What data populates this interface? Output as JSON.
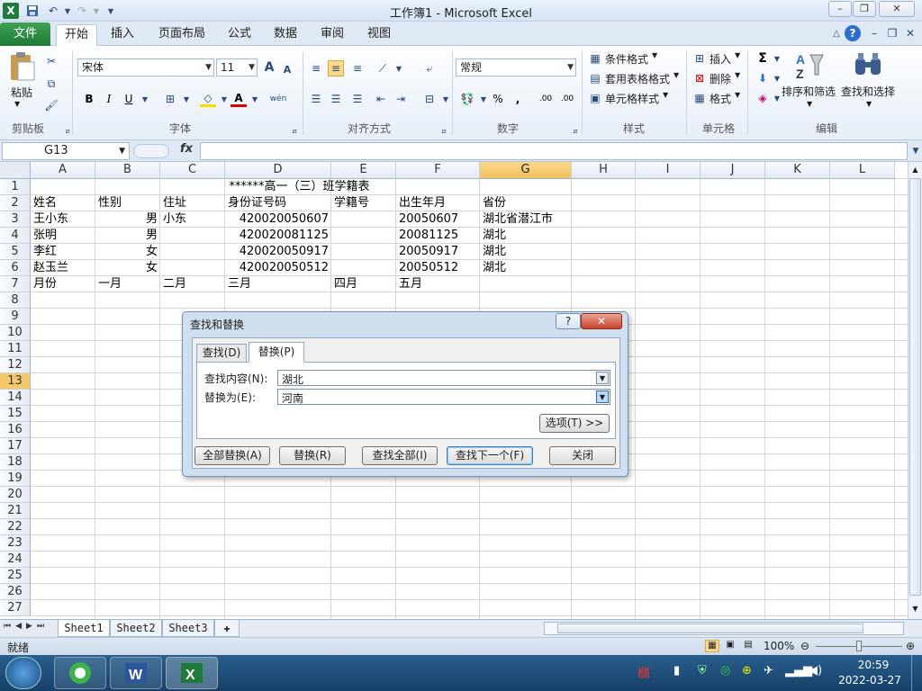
{
  "window": {
    "title": "工作簿1 - Microsoft Excel",
    "minimize": "–",
    "restore": "❐",
    "close": "✕"
  },
  "qat": {
    "save_icon": "save-icon",
    "undo_icon": "undo-icon",
    "redo_icon": "redo-icon"
  },
  "ribbon_tabs": {
    "file": "文件",
    "home": "开始",
    "insert": "插入",
    "page_layout": "页面布局",
    "formulas": "公式",
    "data": "数据",
    "review": "审阅",
    "view": "视图"
  },
  "ribbon": {
    "clipboard": {
      "paste": "粘贴",
      "label": "剪贴板"
    },
    "font": {
      "name": "宋体",
      "size": "11",
      "label": "字体",
      "bold": "B",
      "italic": "I",
      "underline": "U",
      "grow": "A",
      "shrink": "A",
      "wen": "wén"
    },
    "alignment": {
      "label": "对齐方式"
    },
    "number": {
      "format": "常规",
      "label": "数字",
      "percent": "%",
      "comma": ",",
      "inc": ".00",
      "dec": ".00"
    },
    "styles": {
      "conditional": "条件格式",
      "table": "套用表格格式",
      "cell": "单元格样式",
      "label": "样式"
    },
    "cells": {
      "insert": "插入",
      "delete": "删除",
      "format": "格式",
      "label": "单元格"
    },
    "editing": {
      "sigma": "Σ",
      "sort": "排序和筛选",
      "find": "查找和选择",
      "label": "编辑"
    }
  },
  "formula_bar": {
    "name_box": "G13",
    "fx": "fx",
    "value": ""
  },
  "columns": [
    "A",
    "B",
    "C",
    "D",
    "E",
    "F",
    "G",
    "H",
    "I",
    "J",
    "K",
    "L"
  ],
  "selected_column": "G",
  "rows": [
    "1",
    "2",
    "3",
    "4",
    "5",
    "6",
    "7",
    "8",
    "9",
    "10",
    "11",
    "12",
    "13",
    "14",
    "15",
    "16",
    "17",
    "18",
    "19",
    "20",
    "21",
    "22",
    "23",
    "24",
    "25",
    "26",
    "27"
  ],
  "selected_row": "13",
  "sheet": {
    "title": "******高一（三）班学籍表",
    "headers": {
      "name": "姓名",
      "gender": "性别",
      "address": "住址",
      "id": "身份证号码",
      "student_no": "学籍号",
      "birth": "出生年月",
      "province": "省份"
    },
    "records": [
      {
        "name": "王小东",
        "gender": "男",
        "address": "小东",
        "id": "420020050607",
        "birth": "20050607",
        "province": "湖北省潜江市"
      },
      {
        "name": "张明",
        "gender": "男",
        "address": "",
        "id": "420020081125",
        "birth": "20081125",
        "province": "湖北"
      },
      {
        "name": "李红",
        "gender": "女",
        "address": "",
        "id": "420020050917",
        "birth": "20050917",
        "province": "湖北"
      },
      {
        "name": "赵玉兰",
        "gender": "女",
        "address": "",
        "id": "420020050512",
        "birth": "20050512",
        "province": "湖北"
      }
    ],
    "months": {
      "label": "月份",
      "m1": "一月",
      "m2": "二月",
      "m3": "三月",
      "m4": "四月",
      "m5": "五月"
    }
  },
  "dialog": {
    "title": "查找和替换",
    "help": "?",
    "close": "✕",
    "tab_find": "查找(D)",
    "tab_replace": "替换(P)",
    "find_label": "查找内容(N):",
    "find_value": "湖北",
    "replace_label": "替换为(E):",
    "replace_value": "河南",
    "options": "选项(T) >>",
    "replace_all": "全部替换(A)",
    "replace": "替换(R)",
    "find_all": "查找全部(I)",
    "find_next": "查找下一个(F)",
    "close_button": "关闭"
  },
  "sheet_tabs": [
    "Sheet1",
    "Sheet2",
    "Sheet3"
  ],
  "status": {
    "ready": "就绪",
    "zoom": "100%"
  },
  "taskbar": {
    "time": "20:59",
    "date": "2022-03-27"
  },
  "colors": {
    "accent_green": "#1f7a35",
    "ribbon_blue": "#dfe9f5",
    "selection_orange": "#f5c96a"
  }
}
